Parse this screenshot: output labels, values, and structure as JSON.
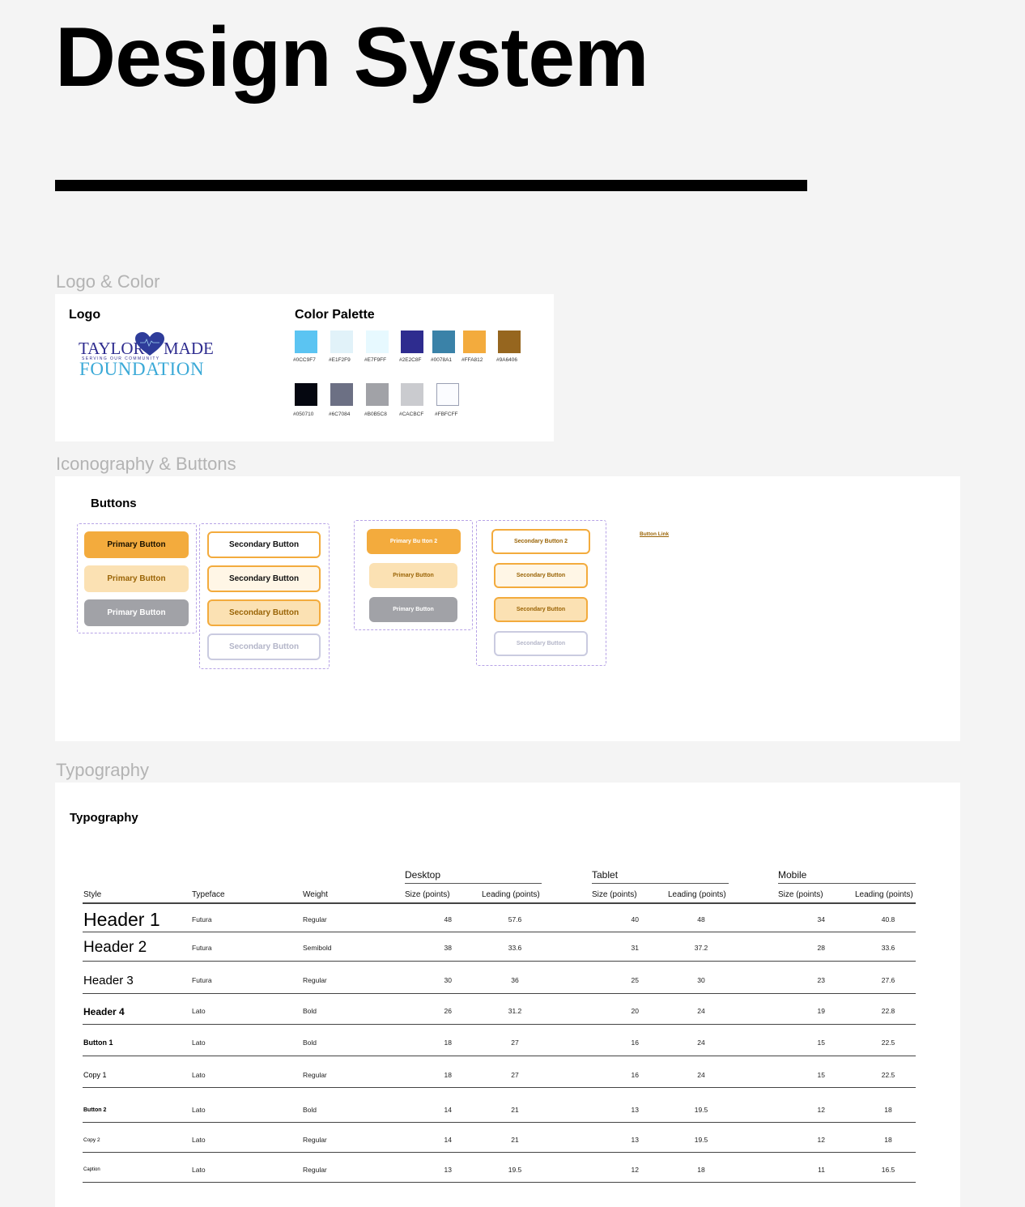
{
  "page_title": "Design System",
  "sections": {
    "logo_color": "Logo & Color",
    "icon_buttons": "Iconography & Buttons",
    "typography": "Typography"
  },
  "logo_card": {
    "logo_title": "Logo",
    "palette_title": "Color Palette",
    "logo": {
      "line1_left": "TAYLOR",
      "line1_right": "MADE",
      "tagline": "SERVING OUR COMMUNITY",
      "line2": "FOUNDATION"
    }
  },
  "palette_row1": [
    {
      "hex": "#0CC9F7",
      "color": "#5bc4f2"
    },
    {
      "hex": "#E1F2F9",
      "color": "#e1f2f9"
    },
    {
      "hex": "#E7F9FF",
      "color": "#e7f9ff"
    },
    {
      "hex": "#2E2C8F",
      "color": "#2e2c8f"
    },
    {
      "hex": "#0078A1",
      "color": "#3a82a8"
    },
    {
      "hex": "#FFA812",
      "color": "#f3ab3d"
    },
    {
      "hex": "#9A6406",
      "color": "#96661f"
    }
  ],
  "palette_row2": [
    {
      "hex": "#050710",
      "color": "#050710"
    },
    {
      "hex": "#6C7084",
      "color": "#6c7084"
    },
    {
      "hex": "#B0B5C8",
      "color": "#a1a2a7"
    },
    {
      "hex": "#CACBCF",
      "color": "#cacbcf"
    },
    {
      "hex": "#FBFCFF",
      "color": "#fbfcff"
    }
  ],
  "buttons_card": {
    "title": "Buttons",
    "primary_large": [
      "Primary Button",
      "Primary Button",
      "Primary Button"
    ],
    "secondary_large": [
      "Secondary Button",
      "Secondary Button",
      "Secondary Button",
      "Secondary Button"
    ],
    "primary_small": [
      "Primary Bu tton 2",
      "Primary Button",
      "Primary Button"
    ],
    "secondary_small": [
      "Secondary Button 2",
      "Secondary Button",
      "Secondary Button",
      "Secondary Button"
    ],
    "link": "Button Link"
  },
  "typography_card": {
    "title": "Typography",
    "groups": [
      "Desktop",
      "Tablet",
      "Mobile"
    ],
    "columns": [
      "Style",
      "Typeface",
      "Weight",
      "Size (points)",
      "Leading (points)",
      "Size (points)",
      "Leading (points)",
      "Size (points)",
      "Leading (points)"
    ],
    "rows": [
      {
        "style": "Header 1",
        "typeface": "Futura",
        "weight": "Regular",
        "d_size": "48",
        "d_lead": "57.6",
        "t_size": "40",
        "t_lead": "48",
        "m_size": "34",
        "m_lead": "40.8"
      },
      {
        "style": "Header 2",
        "typeface": "Futura",
        "weight": "Semibold",
        "d_size": "38",
        "d_lead": "33.6",
        "t_size": "31",
        "t_lead": "37.2",
        "m_size": "28",
        "m_lead": "33.6"
      },
      {
        "style": "Header 3",
        "typeface": "Futura",
        "weight": "Regular",
        "d_size": "30",
        "d_lead": "36",
        "t_size": "25",
        "t_lead": "30",
        "m_size": "23",
        "m_lead": "27.6"
      },
      {
        "style": "Header 4",
        "typeface": "Lato",
        "weight": "Bold",
        "d_size": "26",
        "d_lead": "31.2",
        "t_size": "20",
        "t_lead": "24",
        "m_size": "19",
        "m_lead": "22.8"
      },
      {
        "style": "Button 1",
        "typeface": "Lato",
        "weight": "Bold",
        "d_size": "18",
        "d_lead": "27",
        "t_size": "16",
        "t_lead": "24",
        "m_size": "15",
        "m_lead": "22.5"
      },
      {
        "style": "Copy 1",
        "typeface": "Lato",
        "weight": "Regular",
        "d_size": "18",
        "d_lead": "27",
        "t_size": "16",
        "t_lead": "24",
        "m_size": "15",
        "m_lead": "22.5"
      },
      {
        "style": "Button 2",
        "typeface": "Lato",
        "weight": "Bold",
        "d_size": "14",
        "d_lead": "21",
        "t_size": "13",
        "t_lead": "19.5",
        "m_size": "12",
        "m_lead": "18"
      },
      {
        "style": "Copy 2",
        "typeface": "Lato",
        "weight": "Regular",
        "d_size": "14",
        "d_lead": "21",
        "t_size": "13",
        "t_lead": "19.5",
        "m_size": "12",
        "m_lead": "18"
      },
      {
        "style": "Caption",
        "typeface": "Lato",
        "weight": "Regular",
        "d_size": "13",
        "d_lead": "19.5",
        "t_size": "12",
        "t_lead": "18",
        "m_size": "11",
        "m_lead": "16.5"
      }
    ]
  }
}
